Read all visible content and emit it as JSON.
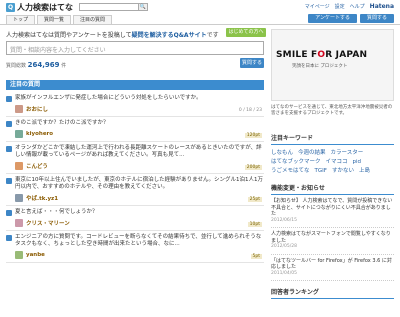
{
  "header": {
    "logo_mark": "Q",
    "logo_text": "人力検索はてな",
    "search_button": "🔍",
    "links": [
      "マイページ",
      "設定",
      "ヘルプ"
    ],
    "hatena": "Hatena"
  },
  "tabs": [
    "トップ",
    "質問一覧",
    "注目の質問"
  ],
  "actions": {
    "ask": "アンケートする",
    "answer": "質問する"
  },
  "intro": {
    "text_before": "人力検索はてなは質問やアンケートを投稿して",
    "text_bold": "疑問を解決するQ&Aサイト",
    "text_after": "です",
    "button": "はじめての方へ"
  },
  "ask": {
    "placeholder": "質問・相談内容を入力してください",
    "count_label": "質問総数",
    "count": "264,969",
    "count_suffix": "件",
    "submit": "質問する"
  },
  "questions_header": "注目の質問",
  "questions": [
    {
      "text": "家族がインフルエンザに発症した場合にどういう対処をしたらいいですか。",
      "user": "おおにし",
      "stats": "0 / 18 / 23"
    },
    {
      "text": "きのこ派ですか？たけのこ派ですか？",
      "user": "kiyohero",
      "stats": "120pt"
    },
    {
      "text": "オランダかどこかで凍結した運河上で行われる長距離スケートのレースがあるときいたのですが、詳しい情報が載っているページがあれば教えてください。写真も見て...",
      "user": "こんどう",
      "stats": "200pt"
    },
    {
      "text": "東京に10年以上住んでいましたが、東京のホテルに宿泊した経験がありません。シングル1泊1人1万円以内で、おすすめのホテルや、その理由を教えてください。",
      "user": "やば.tk.yz1",
      "stats": "25pt"
    },
    {
      "text": "夏と言えば・・・何でしょうか？",
      "user": "クリス・マリーン",
      "stats": "10pt"
    },
    {
      "text": "エンジニアの方に質問です。コードレビューを断らなくてその結果待ちで、並行して進められそうなタスクもなく、ちょっとした空き時間が出来たという場合、なに...",
      "user": "yanbe",
      "stats": "5pt"
    }
  ],
  "sidebar": {
    "banner_title_a": "SMILE F",
    "banner_title_o": "O",
    "banner_title_b": "R JAPAN",
    "banner_sub": "笑顔を日本に プロジェクト",
    "banner_desc": "はてなのサービスを通じて、東北地方太平洋沖地震被災者の皆さまを支援するプロジェクトです。",
    "keywords_title": "注目キーワード",
    "keywords": [
      "しなもん",
      "今週の結果",
      "カラースター",
      "はてなブックマーク",
      "イマココ",
      "pid",
      "うごメモはてな",
      "TGIF",
      "すかない",
      "上島"
    ],
    "feed_title": "機能変更・お知らせ",
    "feed": [
      {
        "text": "【お知らせ】 人力検索はてなで、質問が投稿できない不具合と、サイトにつながりにくい不具合がありました",
        "time": "2012/06/15"
      },
      {
        "text": "人力検索はてながスマートフォンで閲覧しやすくなりました",
        "time": "2012/05/28"
      },
      {
        "text": "「はてなツールバー for Firefox」が Firefox 3.6 に対応しました",
        "time": "2011/04/05"
      }
    ],
    "ranking_title": "回答者ランキング"
  }
}
